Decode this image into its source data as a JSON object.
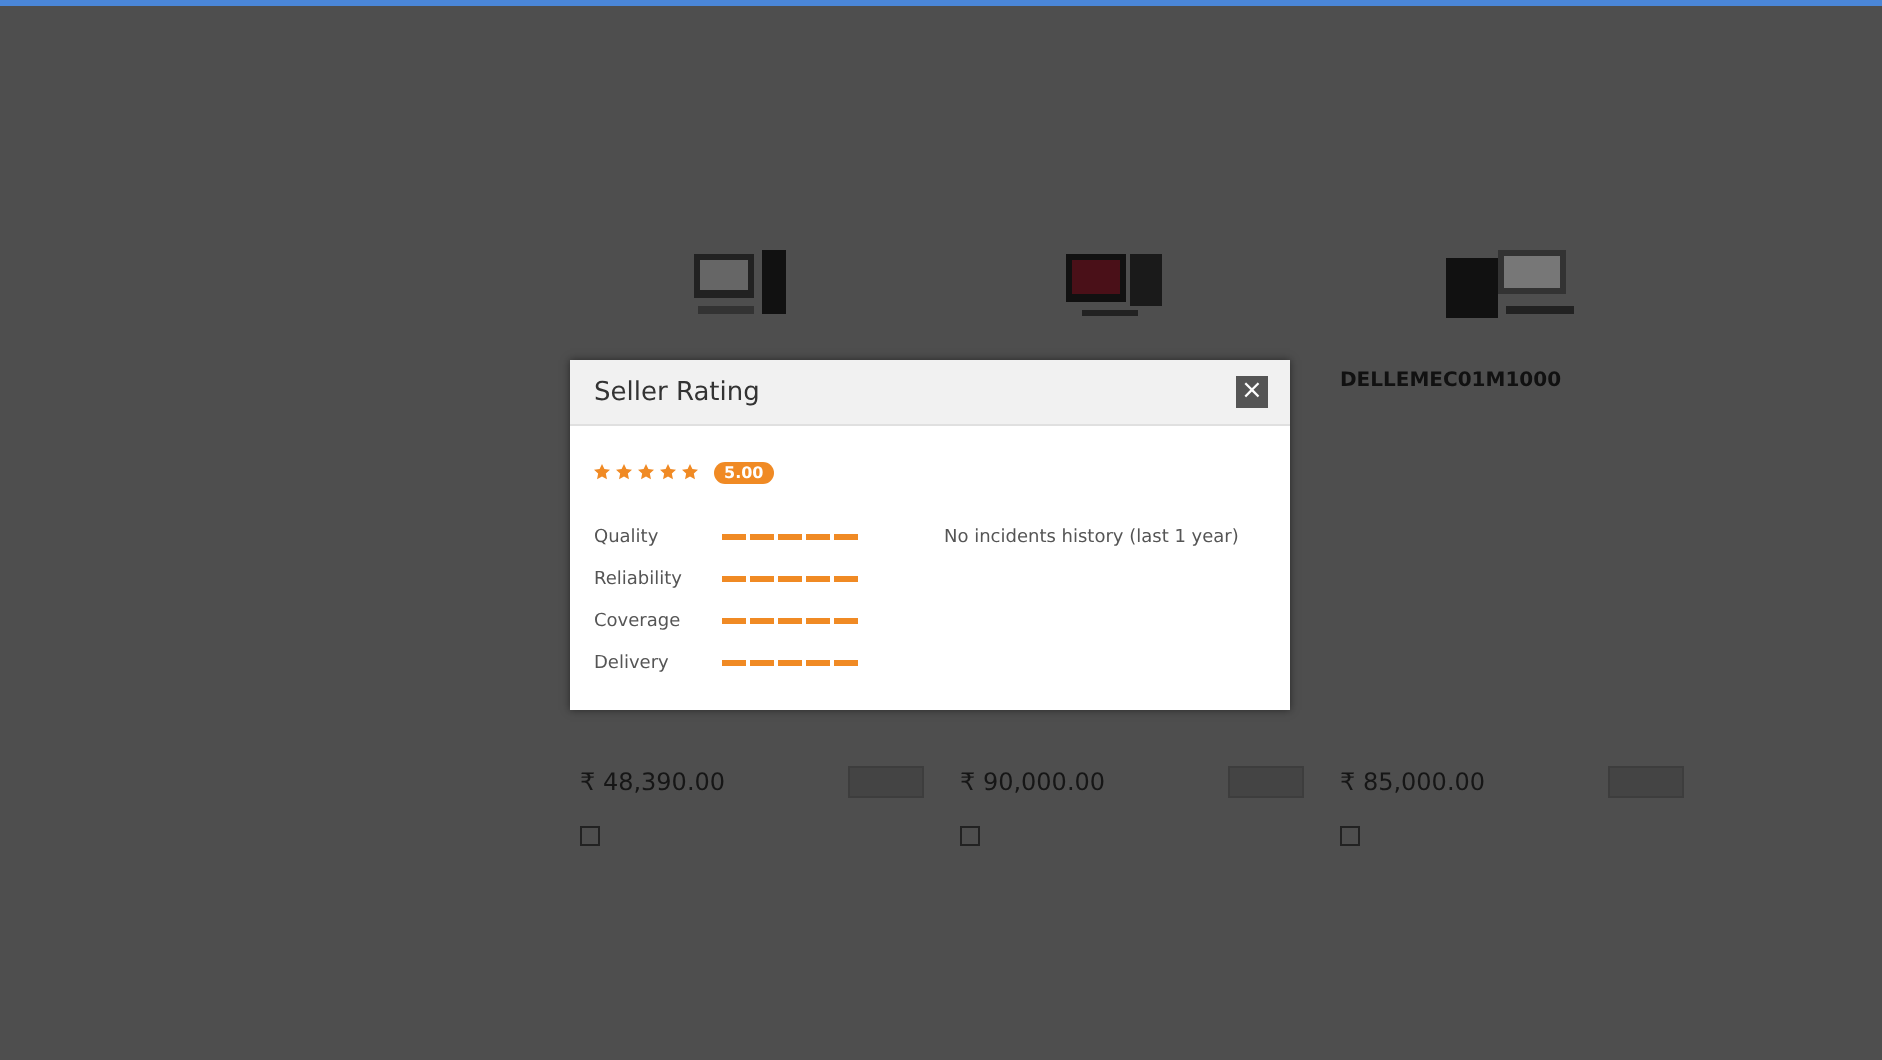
{
  "products": [
    {
      "price": "₹ 48,390.00",
      "checked": false
    },
    {
      "price": "₹ 90,000.00",
      "checked": false
    },
    {
      "name": "DELLEMEC01M1000",
      "price": "₹ 85,000.00",
      "checked": false
    }
  ],
  "modal": {
    "title": "Seller Rating",
    "close": "×",
    "stars": 5,
    "score": "5.00",
    "note": "No incidents history (last 1 year)",
    "criteria": [
      {
        "label": "Quality",
        "stars": 5
      },
      {
        "label": "Reliability",
        "stars": 5
      },
      {
        "label": "Coverage",
        "stars": 5
      },
      {
        "label": "Delivery",
        "stars": 5
      }
    ]
  }
}
